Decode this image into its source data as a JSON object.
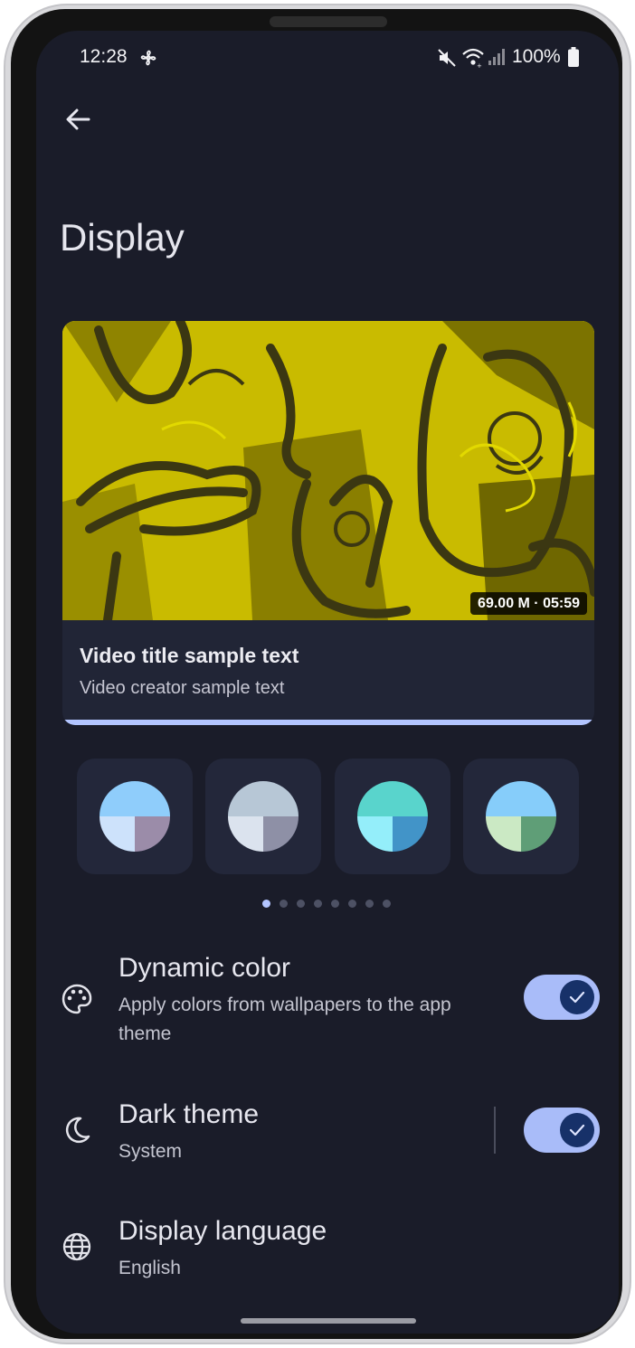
{
  "status_bar": {
    "time": "12:28",
    "battery": "100%",
    "icons": [
      "fan-icon",
      "mute-icon",
      "wifi-icon",
      "signal-icon",
      "battery-icon"
    ]
  },
  "header": {
    "back_icon": "arrow-left-icon",
    "title": "Display"
  },
  "preview": {
    "duration": "69.00 M · 05:59",
    "title": "Video title sample text",
    "creator": "Video creator sample text"
  },
  "palettes": [
    {
      "top": "#8fcdfb",
      "bottom_left": "#cde2fb",
      "bottom_right": "#9b8ca9"
    },
    {
      "top": "#b7c7d6",
      "bottom_left": "#dbe3ee",
      "bottom_right": "#8e90a6"
    },
    {
      "top": "#59d4cc",
      "bottom_left": "#94eefa",
      "bottom_right": "#4294c8"
    },
    {
      "top": "#86cdfa",
      "bottom_left": "#cbe9c4",
      "bottom_right": "#5f9e77"
    }
  ],
  "pager": {
    "count": 8,
    "active": 0
  },
  "settings": {
    "dynamic_color": {
      "icon": "palette-icon",
      "title": "Dynamic color",
      "subtitle_line1": "Apply colors from wallpapers to the app",
      "subtitle_line2": "theme",
      "enabled": true
    },
    "dark_theme": {
      "icon": "moon-icon",
      "title": "Dark theme",
      "subtitle": "System",
      "enabled": true
    },
    "display_language": {
      "icon": "globe-icon",
      "title": "Display language",
      "subtitle": "English"
    }
  },
  "colors": {
    "background": "#1a1c29",
    "accent": "#b3c5ff",
    "toggle_track": "#a9bcf9",
    "toggle_knob": "#173169"
  }
}
